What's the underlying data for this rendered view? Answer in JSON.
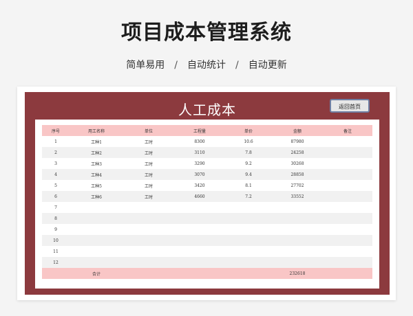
{
  "header": {
    "title": "项目成本管理系统",
    "subtitle": [
      "简单易用",
      "自动统计",
      "自动更新"
    ],
    "separator": "/"
  },
  "sheet": {
    "title": "人工成本",
    "home_button": "返回首页",
    "columns": [
      "序号",
      "用工名称",
      "单位",
      "工程量",
      "单价",
      "金额",
      "备注"
    ],
    "rows": [
      {
        "no": "1",
        "name": "工种1",
        "unit": "工时",
        "qty": "8300",
        "price": "10.6",
        "amount": "87980",
        "note": ""
      },
      {
        "no": "2",
        "name": "工种2",
        "unit": "工时",
        "qty": "3110",
        "price": "7.8",
        "amount": "24258",
        "note": ""
      },
      {
        "no": "3",
        "name": "工种3",
        "unit": "工时",
        "qty": "3290",
        "price": "9.2",
        "amount": "30268",
        "note": ""
      },
      {
        "no": "4",
        "name": "工种4",
        "unit": "工时",
        "qty": "3070",
        "price": "9.4",
        "amount": "28858",
        "note": ""
      },
      {
        "no": "5",
        "name": "工种5",
        "unit": "工时",
        "qty": "3420",
        "price": "8.1",
        "amount": "27702",
        "note": ""
      },
      {
        "no": "6",
        "name": "工种6",
        "unit": "工时",
        "qty": "4660",
        "price": "7.2",
        "amount": "33552",
        "note": ""
      },
      {
        "no": "7",
        "name": "",
        "unit": "",
        "qty": "",
        "price": "",
        "amount": "",
        "note": ""
      },
      {
        "no": "8",
        "name": "",
        "unit": "",
        "qty": "",
        "price": "",
        "amount": "",
        "note": ""
      },
      {
        "no": "9",
        "name": "",
        "unit": "",
        "qty": "",
        "price": "",
        "amount": "",
        "note": ""
      },
      {
        "no": "10",
        "name": "",
        "unit": "",
        "qty": "",
        "price": "",
        "amount": "",
        "note": ""
      },
      {
        "no": "11",
        "name": "",
        "unit": "",
        "qty": "",
        "price": "",
        "amount": "",
        "note": ""
      },
      {
        "no": "12",
        "name": "",
        "unit": "",
        "qty": "",
        "price": "",
        "amount": "",
        "note": ""
      }
    ],
    "total_label": "合计",
    "total_amount": "232618"
  },
  "colors": {
    "frame": "#8c3a3e",
    "header_row": "#f9c6c6",
    "stripe": "#f1f1f1"
  }
}
